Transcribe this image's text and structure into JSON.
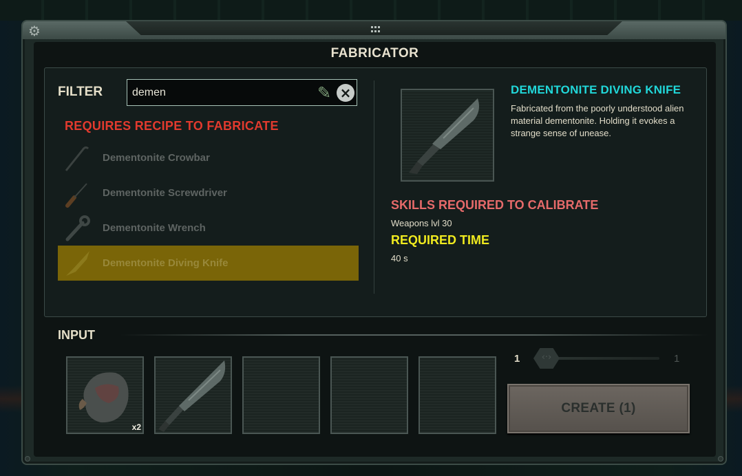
{
  "window": {
    "title": "FABRICATOR",
    "settings_icon": "gear-icon",
    "drag_icon": "grip-icon"
  },
  "filter": {
    "label": "FILTER",
    "value": "demen",
    "edit_icon": "pencil-icon",
    "clear_icon": "close-icon"
  },
  "recipe_list": {
    "heading": "REQUIRES RECIPE TO FABRICATE",
    "items": [
      {
        "label": "Dementonite Crowbar",
        "icon": "crowbar-icon",
        "selected": false
      },
      {
        "label": "Dementonite Screwdriver",
        "icon": "screwdriver-icon",
        "selected": false
      },
      {
        "label": "Dementonite Wrench",
        "icon": "wrench-icon",
        "selected": false
      },
      {
        "label": "Dementonite Diving Knife",
        "icon": "knife-icon",
        "selected": true
      }
    ]
  },
  "detail": {
    "name": "DEMENTONITE DIVING KNIFE",
    "description": "Fabricated from the poorly understood alien material dementonite. Holding it evokes a strange sense of unease.",
    "skills_heading": "SKILLS REQUIRED TO CALIBRATE",
    "skills_value": "Weapons lvl 30",
    "time_heading": "REQUIRED TIME",
    "time_value": "40 s"
  },
  "input": {
    "label": "INPUT",
    "slots": [
      {
        "icon": "dementonite-ore-icon",
        "count": "x2"
      },
      {
        "icon": "knife-icon",
        "count": ""
      },
      {
        "icon": "",
        "count": ""
      },
      {
        "icon": "",
        "count": ""
      },
      {
        "icon": "",
        "count": ""
      }
    ]
  },
  "quantity": {
    "min": "1",
    "max": "1",
    "handle_glyph": "‹·›"
  },
  "create_button": {
    "label": "CREATE (1)"
  },
  "colors": {
    "title": "#e8e2cf",
    "recipe_heading": "#e23a2e",
    "item_name": "#21d7d9",
    "skills_heading": "#e66a6a",
    "time_heading": "#f0ea1f",
    "selected_row": "#7a6508"
  }
}
